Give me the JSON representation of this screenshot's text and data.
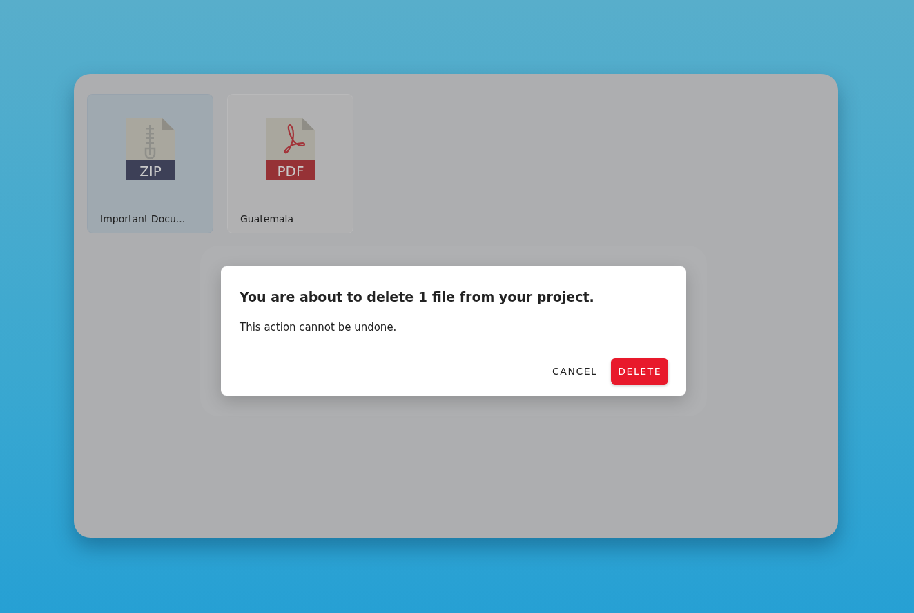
{
  "files": [
    {
      "name": "Important Docu...",
      "kind": "zip",
      "badge": "ZIP",
      "selected": true
    },
    {
      "name": "Guatemala",
      "kind": "pdf",
      "badge": "PDF",
      "selected": false
    }
  ],
  "dialog": {
    "title": "You are about to delete 1 file from your project.",
    "message": "This action cannot be undone.",
    "buttons": [
      {
        "label": "CANCEL",
        "kind": "text"
      },
      {
        "label": "DELETE",
        "kind": "danger"
      }
    ]
  }
}
